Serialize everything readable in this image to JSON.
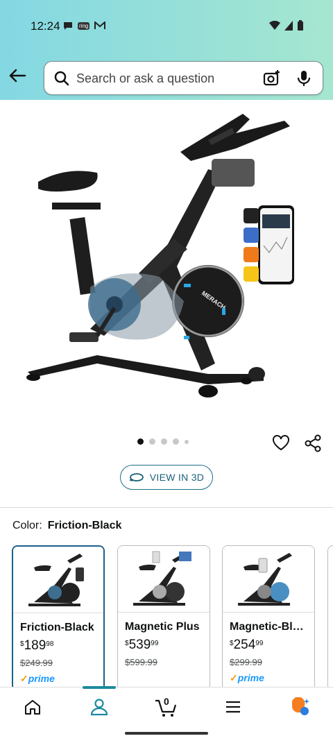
{
  "status": {
    "time": "12:24",
    "ring_label": "ring"
  },
  "search": {
    "placeholder": "Search or ask a question"
  },
  "product_image": {
    "brand_text": "MERACH"
  },
  "carousel": {
    "total": 5,
    "active_index": 0
  },
  "view3d": {
    "label": "VIEW IN 3D"
  },
  "color": {
    "key": "Color:",
    "value": "Friction-Black"
  },
  "variants": [
    {
      "name": "Friction-Black",
      "currency": "$",
      "price_whole": "189",
      "price_frac": "98",
      "list_price": "$249.99",
      "prime": "prime",
      "selected": true
    },
    {
      "name": "Magnetic Plus",
      "currency": "$",
      "price_whole": "539",
      "price_frac": "99",
      "list_price": "$599.99",
      "prime": "",
      "selected": false
    },
    {
      "name": "Magnetic-Bl…",
      "currency": "$",
      "price_whole": "254",
      "price_frac": "99",
      "list_price": "$299.99",
      "prime": "prime",
      "selected": false
    }
  ],
  "bottomnav": {
    "cart_count": "0",
    "items": [
      "home-icon",
      "account-icon",
      "cart-icon",
      "menu-icon",
      "rufus-icon"
    ]
  },
  "colors": {
    "accent": "#1a5f8a",
    "prime": "#1a98ff",
    "header_grad_start": "#84d8e3",
    "header_grad_end": "#a5e6cf"
  }
}
